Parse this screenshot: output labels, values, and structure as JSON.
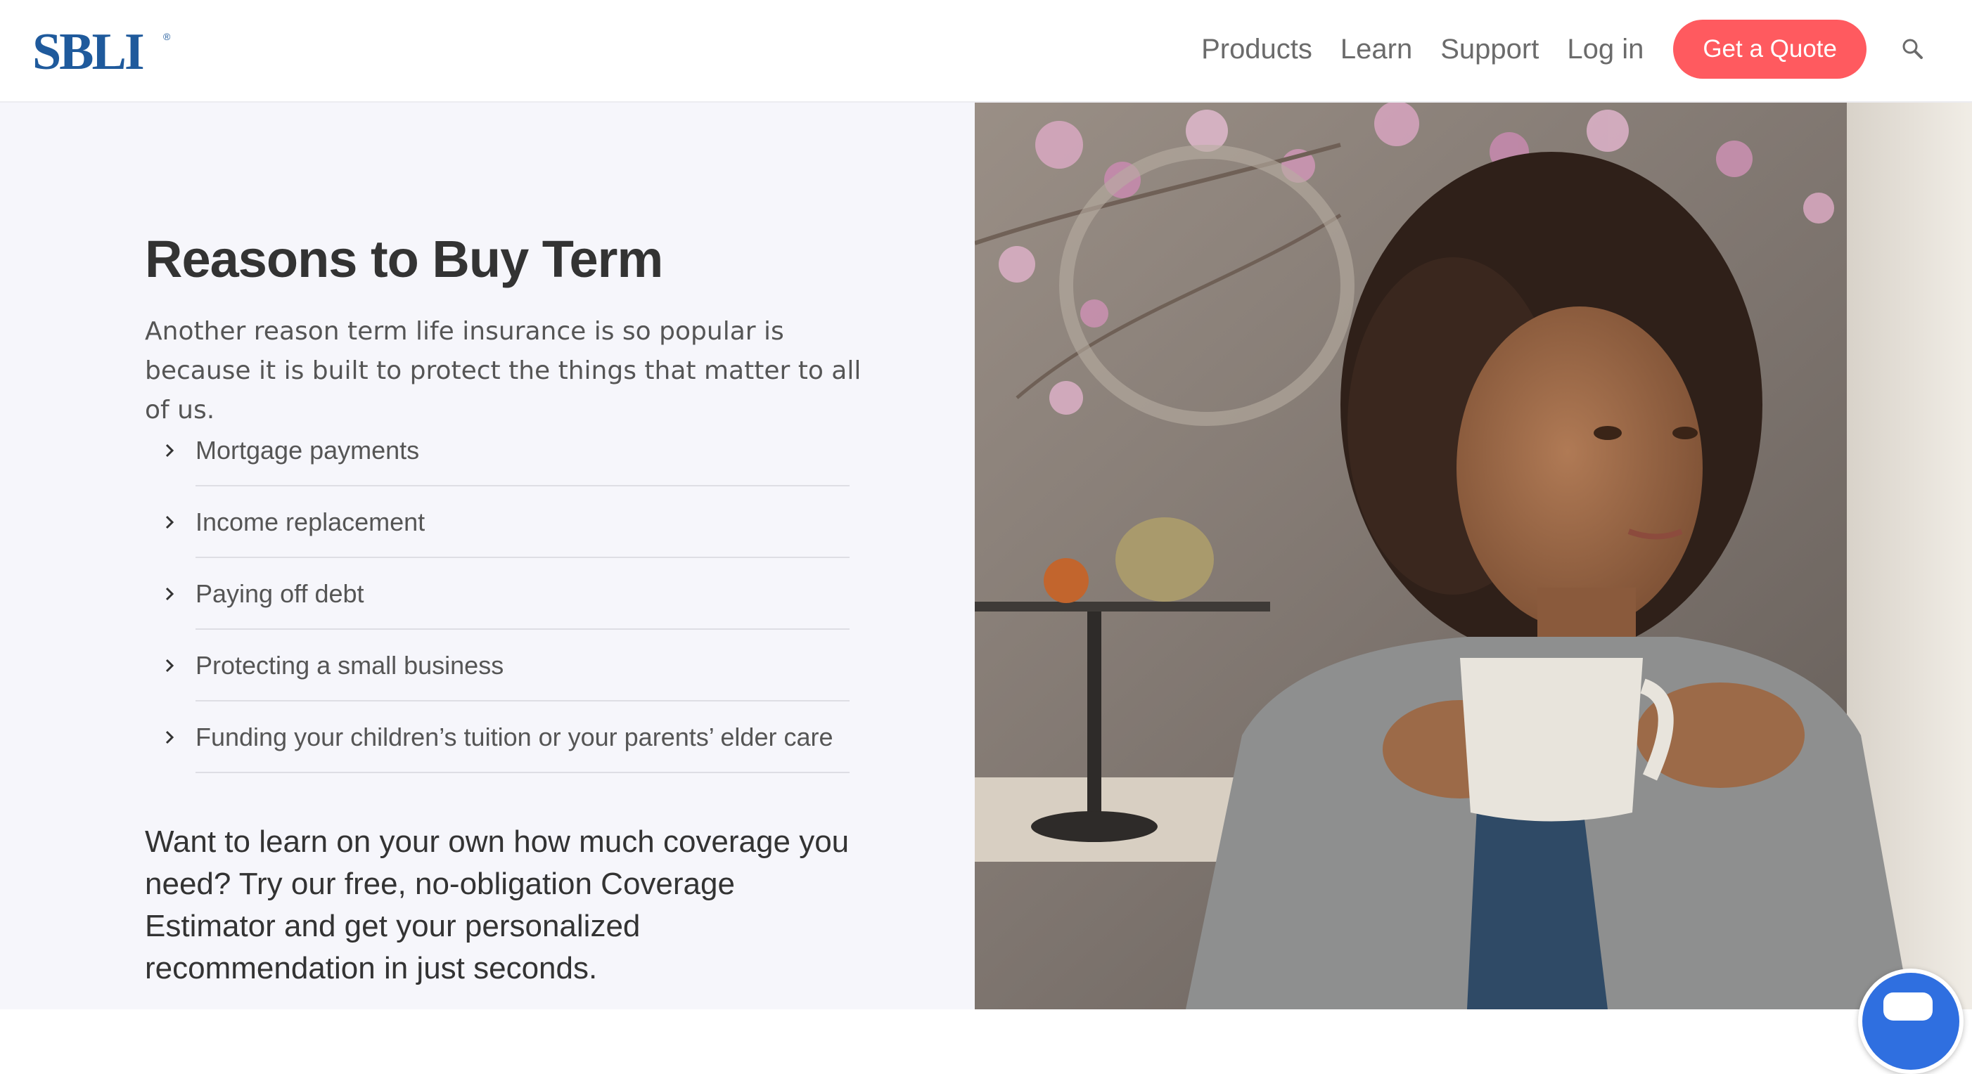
{
  "header": {
    "logo_text": "SBLI",
    "logo_mark": "®",
    "nav": [
      {
        "label": "Products"
      },
      {
        "label": "Learn"
      },
      {
        "label": "Support"
      },
      {
        "label": "Log in"
      }
    ],
    "cta_label": "Get a Quote",
    "search_icon": "search-icon",
    "colors": {
      "brand_blue": "#1f5a9c",
      "cta_red": "#ff5a5f"
    }
  },
  "main": {
    "title": "Reasons to Buy Term",
    "intro": "Another reason term life insurance is so popular is because it is built to protect the things that matter to all of us.",
    "reasons": [
      {
        "label": "Mortgage payments"
      },
      {
        "label": "Income replacement"
      },
      {
        "label": "Paying off debt"
      },
      {
        "label": "Protecting a small business"
      },
      {
        "label": "Funding your children’s tuition or your parents’ elder care"
      }
    ],
    "bullet_icon": "chevron-right-icon",
    "cta_text": "Want to learn on your own how much coverage you need? Try our free, no-obligation Coverage Estimator and get your personalized recommendation in just seconds."
  },
  "hero_image": {
    "subject": "woman-holding-mug-photo"
  },
  "chat": {
    "icon": "chat-icon",
    "color": "#2f6fe0"
  }
}
